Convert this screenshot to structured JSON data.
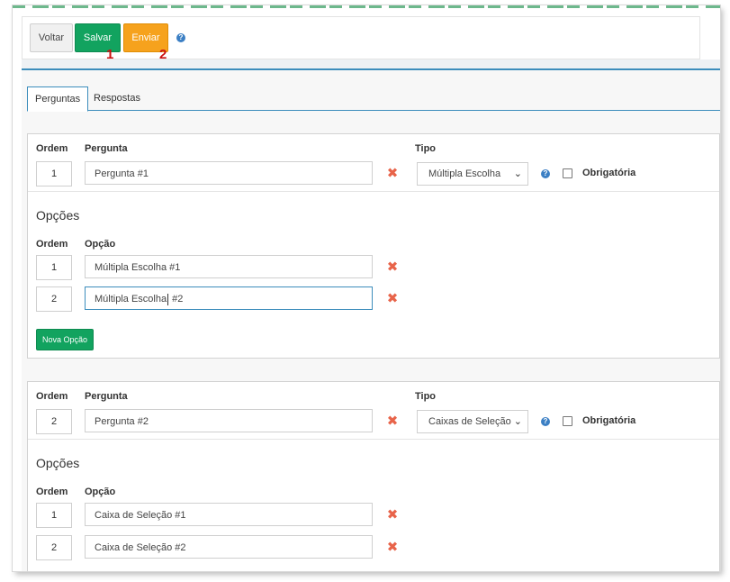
{
  "toolbar": {
    "voltar": "Voltar",
    "salvar": "Salvar",
    "enviar": "Enviar",
    "help": "?",
    "callout_1": "1",
    "callout_2": "2"
  },
  "tabs": [
    {
      "label": "Perguntas",
      "active": true
    },
    {
      "label": "Respostas",
      "active": false
    }
  ],
  "labels": {
    "ordem": "Ordem",
    "pergunta": "Pergunta",
    "tipo": "Tipo",
    "opcoes": "Opções",
    "opcao": "Opção",
    "obrigatoria": "Obrigatória",
    "nova_opcao": "Nova Opção"
  },
  "questions": [
    {
      "ordem": "1",
      "pergunta": "Pergunta #1",
      "tipo": "Múltipla Escolha",
      "obrigatoria": false,
      "options": [
        {
          "ordem": "1",
          "opcao": "Múltipla Escolha #1"
        },
        {
          "ordem": "2",
          "opcao_before_caret": "Múltipla Escolha",
          "opcao_after_caret": " #2"
        }
      ]
    },
    {
      "ordem": "2",
      "pergunta": "Pergunta #2",
      "tipo": "Caixas de Seleção",
      "obrigatoria": false,
      "options": [
        {
          "ordem": "1",
          "opcao": "Caixa de Seleção  #1"
        },
        {
          "ordem": "2",
          "opcao": "Caixa de Seleção  #2"
        }
      ]
    }
  ],
  "colors": {
    "salvar": "#12a35f",
    "enviar": "#f6a21d",
    "accent": "#3c8dbc",
    "delete": "#e8644a",
    "callout": "#cc1212"
  },
  "icons": {
    "help": "question-circle-icon",
    "delete": "times-icon",
    "dropdown": "chevron-down-icon"
  }
}
